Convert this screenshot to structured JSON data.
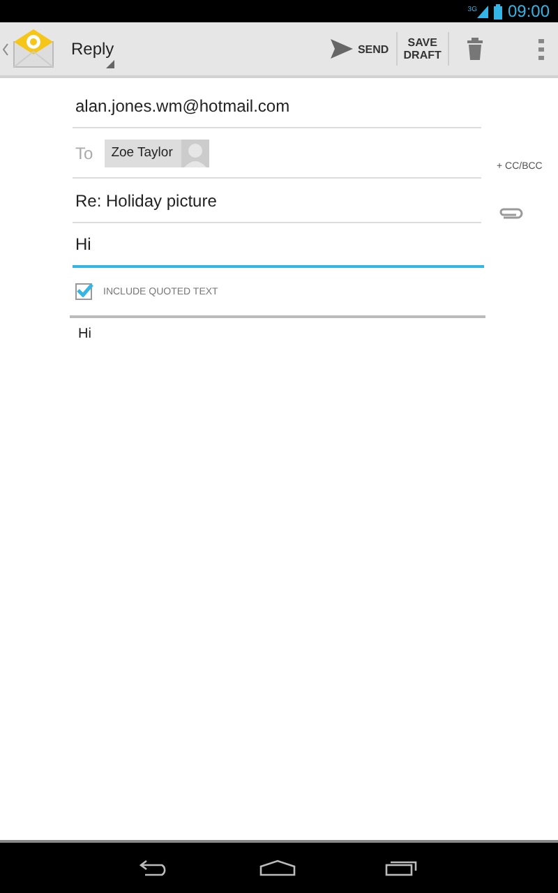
{
  "status_bar": {
    "network": "3G",
    "time": "09:00"
  },
  "action_bar": {
    "title": "Reply",
    "send": "SEND",
    "save_draft": "SAVE DRAFT"
  },
  "compose": {
    "from": "alan.jones.wm@hotmail.com",
    "to_label": "To",
    "recipients": [
      {
        "name": "Zoe Taylor"
      }
    ],
    "cc_bcc": "+ CC/BCC",
    "subject": "Re: Holiday picture",
    "body": "Hi",
    "include_quoted": {
      "label": "INCLUDE QUOTED TEXT",
      "checked": true
    },
    "quoted_text": "Hi"
  }
}
